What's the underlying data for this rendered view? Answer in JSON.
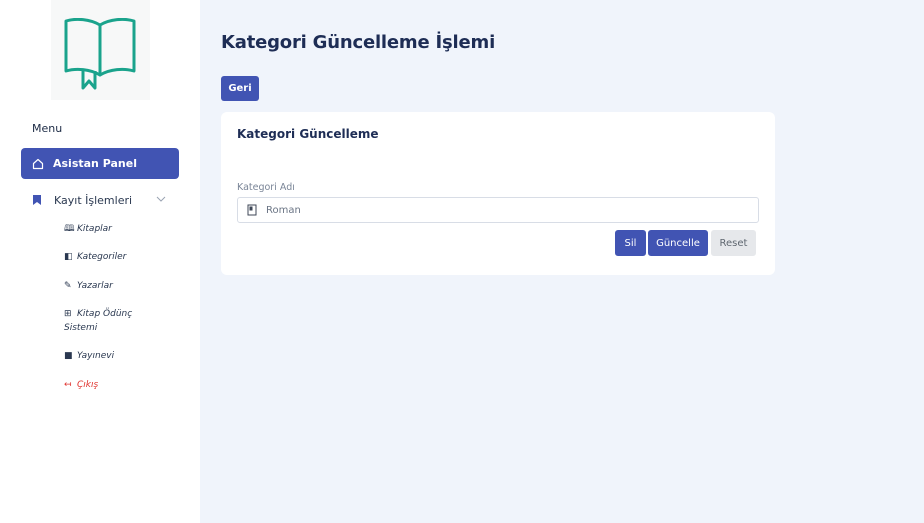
{
  "sidebar": {
    "logo_icon": "open-book-icon",
    "menu_heading": "Menu",
    "active_item": {
      "label": "Asistan Panel",
      "icon": "home-icon"
    },
    "group": {
      "label": "Kayıt İşlemleri",
      "icon": "bookmark-icon",
      "expanded": true
    },
    "sub_items": [
      {
        "label": "Kitaplar",
        "icon": "book-icon"
      },
      {
        "label": "Kategoriler",
        "icon": "journal-icon"
      },
      {
        "label": "Yazarlar",
        "icon": "pen-icon"
      },
      {
        "label": "Kitap Ödünç",
        "label2": "Sistemi",
        "icon": "plus-square-icon"
      },
      {
        "label": "Yayınevi",
        "icon": "building-icon"
      },
      {
        "label": "Çıkış",
        "icon": "logout-icon"
      }
    ]
  },
  "main": {
    "title": "Kategori Güncelleme İşlemi",
    "back_button": "Geri",
    "card": {
      "title": "Kategori Güncelleme",
      "field_label": "Kategori Adı",
      "field_value": "Roman",
      "field_icon": "book-icon",
      "buttons": {
        "delete": "Sil",
        "update": "Güncelle",
        "reset": "Reset"
      }
    }
  },
  "colors": {
    "primary": "#4154b3",
    "logo": "#1aa38c",
    "background": "#f0f4fb",
    "danger": "#e0342f"
  }
}
